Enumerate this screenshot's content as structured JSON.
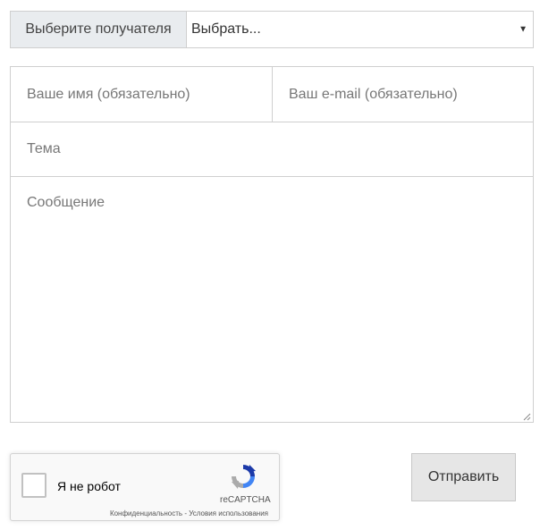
{
  "recipient": {
    "label": "Выберите получателя",
    "selected": "Выбрать..."
  },
  "form": {
    "name_placeholder": "Ваше имя (обязательно)",
    "email_placeholder": "Ваш e-mail (обязательно)",
    "subject_placeholder": "Тема",
    "message_placeholder": "Сообщение"
  },
  "captcha": {
    "label": "Я не робот",
    "brand": "reCAPTCHA",
    "privacy_link": "Конфиденциальность",
    "separator": " - ",
    "terms_link": "Условия использования"
  },
  "submit": {
    "label": "Отправить"
  },
  "colors": {
    "label_bg": "#e9ecef",
    "border": "#cfcfcf",
    "button_bg": "#e6e6e6"
  }
}
